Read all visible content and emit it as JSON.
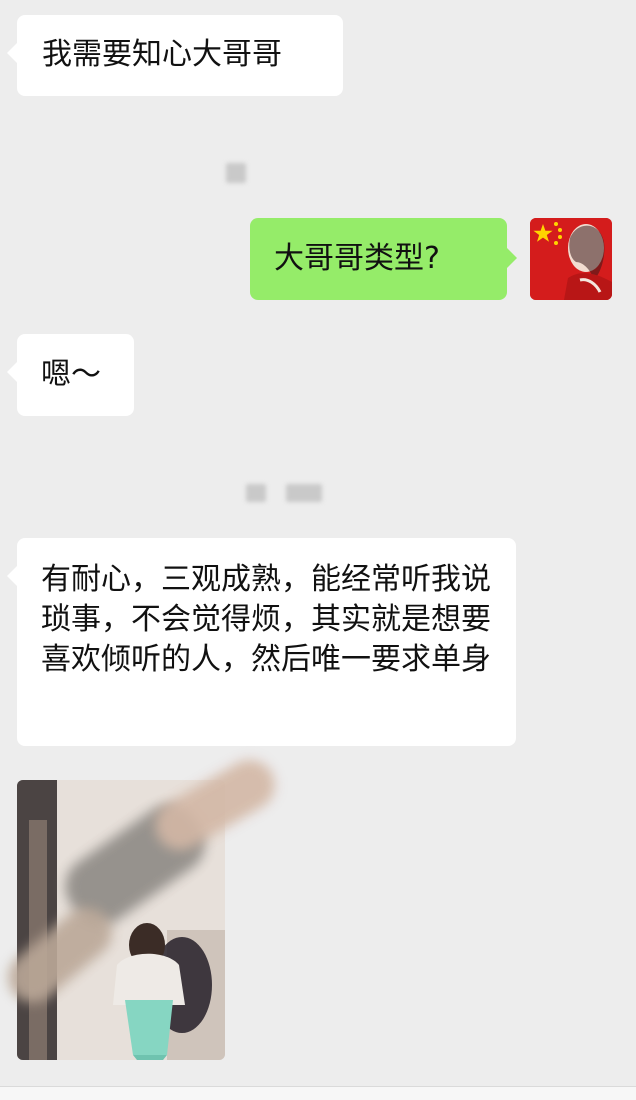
{
  "messages": [
    {
      "id": "msg1",
      "side": "incoming",
      "text": "我需要知心大哥哥"
    },
    {
      "id": "msg2",
      "side": "outgoing",
      "text": "大哥哥类型?"
    },
    {
      "id": "msg3",
      "side": "incoming",
      "text": "嗯～"
    },
    {
      "id": "msg4",
      "side": "incoming",
      "text": "有耐心，三观成熟，能经常听我说琐事，不会觉得烦，其实就是想要喜欢倾听的人，然后唯一要求单身"
    }
  ],
  "colors": {
    "background": "#ededed",
    "incoming_bubble": "#ffffff",
    "outgoing_bubble": "#95ec69"
  },
  "avatar": {
    "icon": "flag-avatar-icon"
  },
  "photo": {
    "icon": "photo-message-icon"
  }
}
